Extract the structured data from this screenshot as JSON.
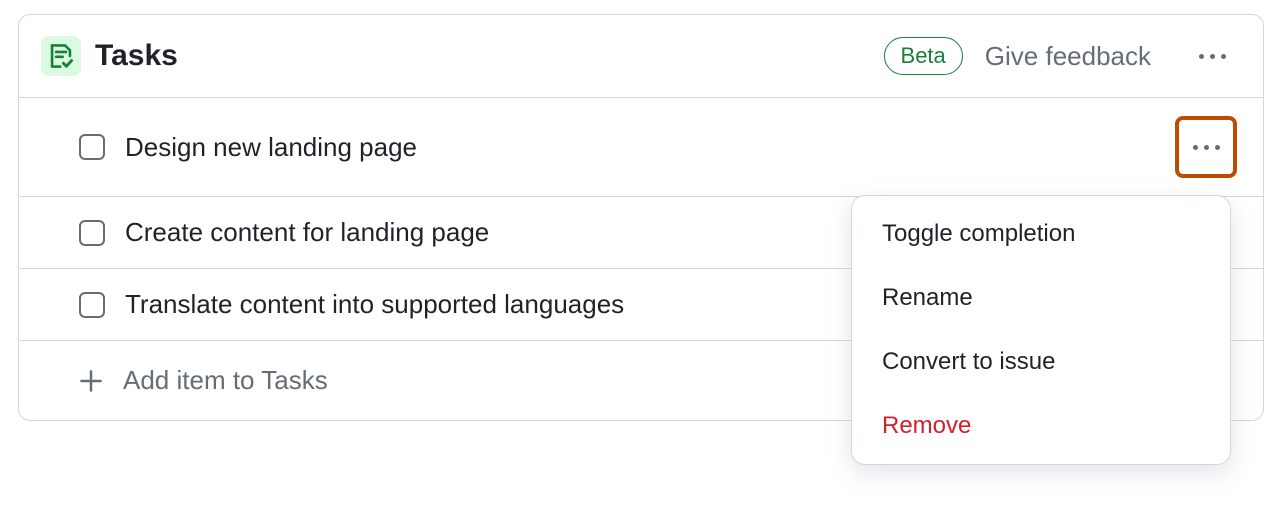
{
  "header": {
    "title": "Tasks",
    "badge": "Beta",
    "feedback": "Give feedback"
  },
  "tasks": [
    {
      "title": "Design new landing page"
    },
    {
      "title": "Create content for landing page"
    },
    {
      "title": "Translate content into supported languages"
    }
  ],
  "footer": {
    "add_label": "Add item to Tasks"
  },
  "menu": {
    "toggle": "Toggle completion",
    "rename": "Rename",
    "convert": "Convert to issue",
    "remove": "Remove"
  }
}
